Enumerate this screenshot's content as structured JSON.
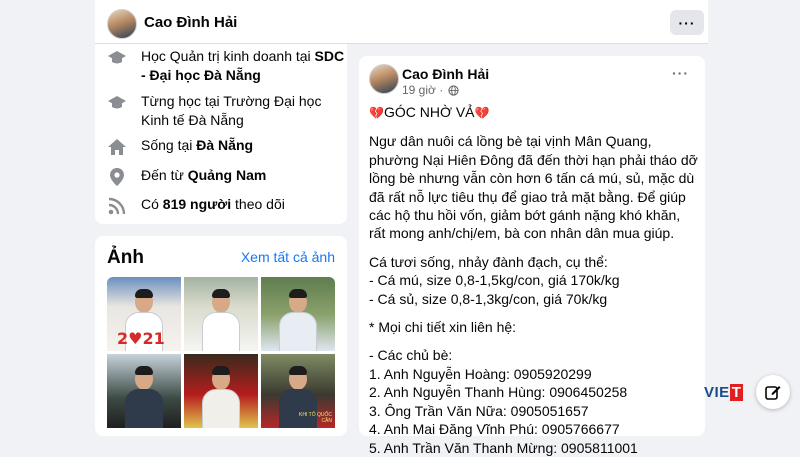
{
  "header": {
    "name": "Cao Đình Hải",
    "more": "···"
  },
  "intro": {
    "items": [
      {
        "icon": "graduation-cap-icon",
        "pre": "Học Quản trị kinh doanh tại ",
        "bold": "SDC - Đại học Đà Nẵng",
        "post": ""
      },
      {
        "icon": "graduation-cap-icon",
        "pre": "Từng học tại Trường Đại học Kinh tế Đà Nẵng",
        "bold": "",
        "post": ""
      },
      {
        "icon": "home-icon",
        "pre": "Sống tại ",
        "bold": "Đà Nẵng",
        "post": ""
      },
      {
        "icon": "location-pin-icon",
        "pre": "Đến từ ",
        "bold": "Quảng Nam",
        "post": ""
      },
      {
        "icon": "rss-icon",
        "pre": "Có ",
        "bold": "819 người",
        "post": " theo dõi"
      }
    ]
  },
  "photos": {
    "title": "Ảnh",
    "see_all": "Xem tất cả ảnh",
    "caption_year": "2♥21",
    "caption_tag": "KHI TÔ QUỐC CẦN"
  },
  "post": {
    "author": "Cao Đình Hải",
    "time": "19 giờ ·",
    "more": "···",
    "heading": "GÓC NHỜ VẢ",
    "heading_heart": "💔",
    "paragraph": "Ngư dân nuôi cá lồng bè tại vịnh Mân Quang, phường Nại Hiên Đông đã đến thời hạn phải tháo dỡ lồng bè nhưng vẫn còn hơn 6 tấn cá mú, sủ, mặc dù đã rất nỗ lực tiêu thụ để giao trả mặt bằng. Để giúp các hộ thu hồi vốn, giảm bớt gánh nặng khó khăn, rất mong anh/chị/em, bà con nhân dân mua giúp.",
    "fish_lines": [
      "Cá tươi sống, nhảy đành đạch, cụ thể:",
      "- Cá mú, size 0,8-1,5kg/con, giá 170k/kg",
      "- Cá sủ, size 0,8-1,3kg/con, giá 70k/kg"
    ],
    "contact_heading": "* Mọi chi tiết xin liên hệ:",
    "contact_lines": [
      "- Các chủ bè:",
      "1. Anh Nguyễn Hoàng: 0905920299",
      "2. Anh Nguyễn Thanh Hùng: 0906450258",
      "3. Ông Trần Văn Nữa: 0905051657",
      "4. Anh Mai Đăng Vĩnh Phú: 0905766677",
      "5. Anh Trần Văn Thanh Mừng: 0905811001"
    ]
  },
  "watermark": {
    "left": "VIE",
    "right": "T"
  },
  "colors": {
    "link": "#1877f2",
    "card": "#ffffff",
    "background": "#f0f2f5"
  }
}
